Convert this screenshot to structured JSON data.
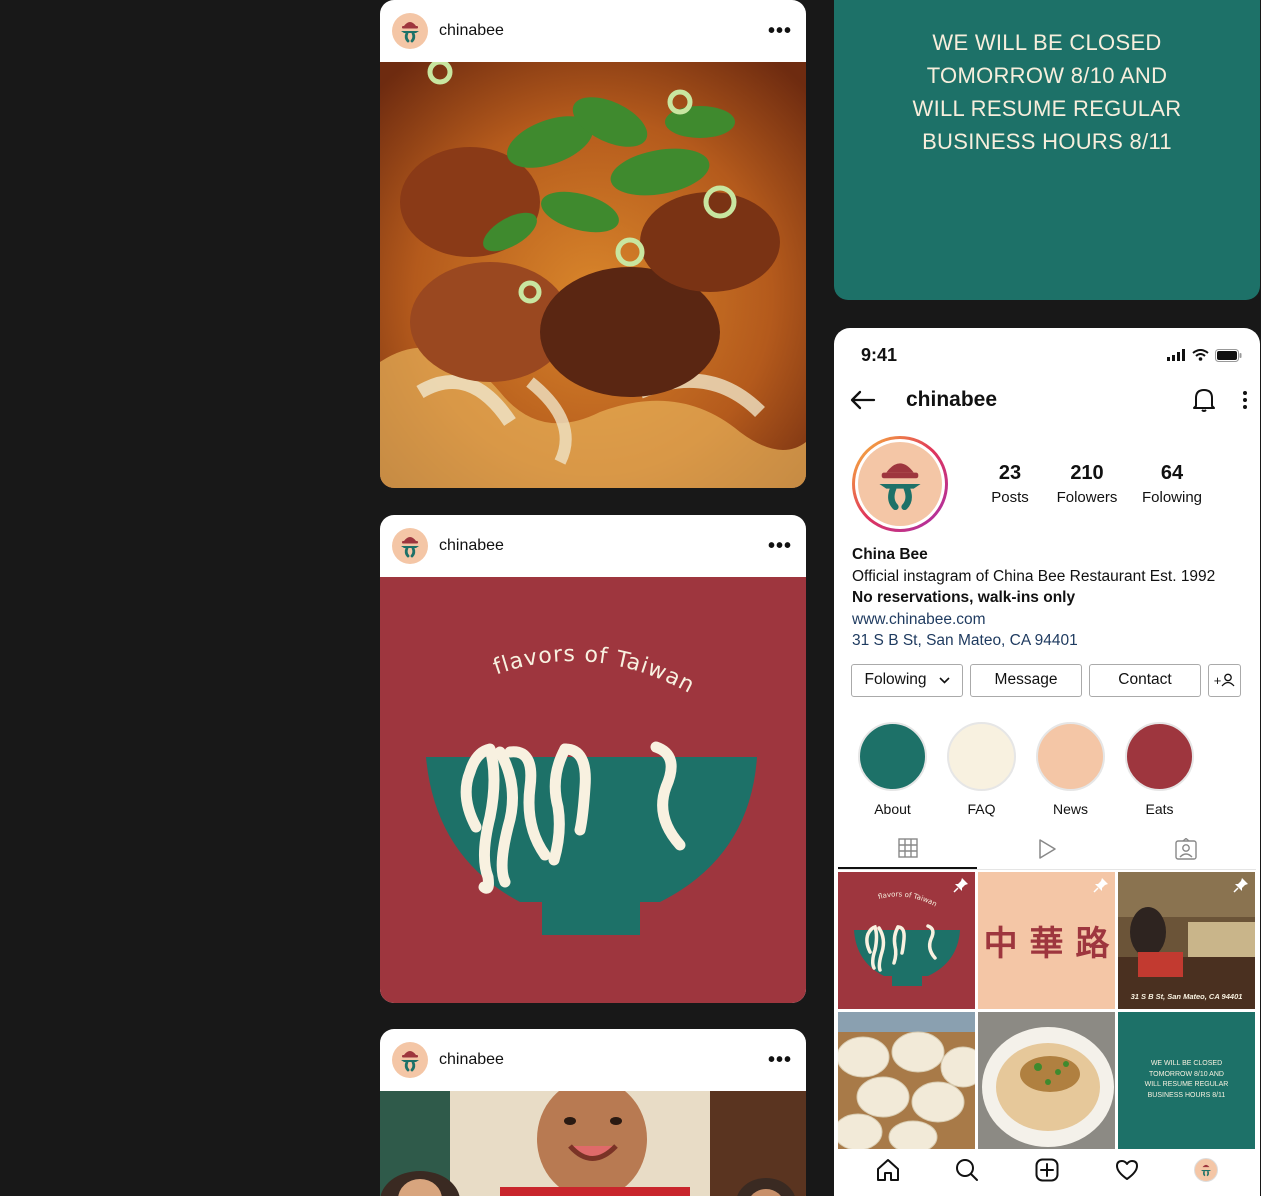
{
  "feed": {
    "posts": [
      {
        "username": "chinabee",
        "more": "•••",
        "media": "beef noodle soup photo"
      },
      {
        "username": "chinabee",
        "more": "•••",
        "media": "flavors of Taiwan graphic",
        "graphic_text": "flavors of Taiwan"
      },
      {
        "username": "chinabee",
        "more": "•••",
        "media": "staff portrait photo"
      }
    ]
  },
  "notice": {
    "lines": [
      "WE WILL BE CLOSED",
      "TOMORROW 8/10 AND",
      "WILL RESUME REGULAR",
      "BUSINESS HOURS 8/11"
    ]
  },
  "phone": {
    "status_time": "9:41",
    "status_icons": [
      "signal-icon",
      "wifi-icon",
      "battery-icon"
    ],
    "nav": {
      "back_icon": "arrow-left-icon",
      "title": "chinabee",
      "bell_icon": "bell-icon",
      "menu_icon": "more-vertical-icon"
    },
    "stats": [
      {
        "value": "23",
        "label": "Posts"
      },
      {
        "value": "210",
        "label": "Folowers"
      },
      {
        "value": "64",
        "label": "Folowing"
      }
    ],
    "bio": {
      "name": "China Bee",
      "description": "Official instagram of China Bee Restaurant Est. 1992",
      "note": "No reservations, walk-ins only",
      "website": "www.chinabee.com",
      "address": "31 S B St, San Mateo, CA 94401"
    },
    "buttons": {
      "following": "Folowing",
      "message": "Message",
      "contact": "Contact",
      "add_user": "+"
    },
    "highlights": [
      {
        "label": "About",
        "color": "#1d7168"
      },
      {
        "label": "FAQ",
        "color": "#f8f1e0"
      },
      {
        "label": "News",
        "color": "#f4c6a6"
      },
      {
        "label": "Eats",
        "color": "#9e363e"
      }
    ],
    "tabs": [
      "grid-icon",
      "reels-icon",
      "tagged-icon"
    ],
    "grid": {
      "cell1_text": "flavors of Taiwan",
      "cell2_text": "中 華 路",
      "cell3_caption": "31 S B St, San Mateo, CA 94401",
      "cell6_lines": [
        "WE WILL BE CLOSED",
        "TOMORROW 8/10 AND",
        "WILL RESUME REGULAR",
        "BUSINESS HOURS 8/11"
      ]
    },
    "bottom_nav": [
      "home-icon",
      "search-icon",
      "new-post-icon",
      "heart-icon",
      "profile-icon"
    ]
  },
  "colors": {
    "teal": "#1d7168",
    "red": "#9e363e",
    "cream": "#f8f1e0",
    "peach": "#f4c6a6"
  }
}
